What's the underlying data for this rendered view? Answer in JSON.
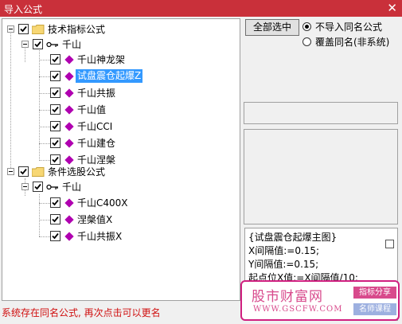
{
  "window": {
    "title": "导入公式",
    "close_glyph": "✕"
  },
  "tree": {
    "groups": [
      {
        "label": "技术指标公式",
        "author": "千山",
        "items": [
          "千山神龙架",
          "试盘震仓起爆Z",
          "千山共振",
          "千山值",
          "千山CCI",
          "千山建仓",
          "千山涅槃"
        ],
        "selected_item": "试盘震仓起爆Z"
      },
      {
        "label": "条件选股公式",
        "author": "千山",
        "items": [
          "千山C400X",
          "涅槃值X",
          "千山共振X"
        ]
      }
    ]
  },
  "actions": {
    "select_all_label": "全部选中"
  },
  "options": {
    "no_import_same_name": "不导入同名公式",
    "overwrite_same_name": "覆盖同名(非系统)",
    "selected": "no_import_same_name"
  },
  "code_preview": {
    "lines": [
      "{试盘震仓起爆主图}",
      "X间隔值:=0.15;",
      "Y间隔值:=0.15;",
      "起点位X值:=X间隔值/10;"
    ]
  },
  "status": {
    "message": "系统存在同名公式, 再次点击可以更名"
  },
  "watermark": {
    "site_name": "股市财富网",
    "url": "WWW.GSCFW.COM",
    "tag1": "指标分享",
    "tag2": "名师课程"
  },
  "colors": {
    "title_bar": "#c9303a",
    "selection": "#3399ff",
    "status_text": "#d01010",
    "formula_icon": "#b000b0"
  }
}
